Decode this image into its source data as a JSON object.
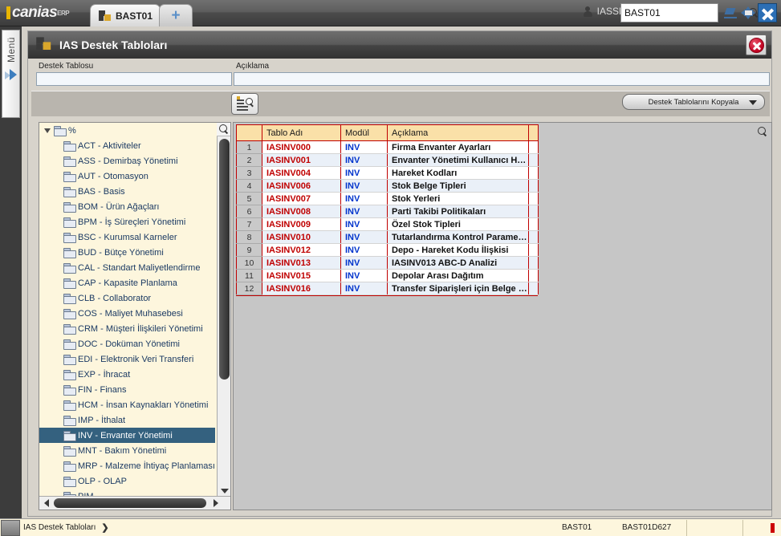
{
  "app": {
    "logo_text": "canias",
    "logo_sup": "ERP",
    "user": "IASSETUP",
    "command_value": "BAST01",
    "command_placeholder": ""
  },
  "tabs": [
    {
      "label": "BAST01",
      "icon": "puzzle-icon"
    },
    {
      "label": "+",
      "icon": "plus-icon"
    }
  ],
  "window_controls": {
    "minimize": "minimize-icon",
    "restore": "restore-icon",
    "close": "close-icon"
  },
  "rail": {
    "label": "Menü",
    "expand_icon": "expand-arrow-icon"
  },
  "dialog": {
    "title": "IAS Destek Tabloları",
    "close_label": "×"
  },
  "form": {
    "destek_tablosu": {
      "label": "Destek Tablosu",
      "value": "",
      "placeholder": ""
    },
    "aciklama": {
      "label": "Açıklama",
      "value": "",
      "placeholder": ""
    }
  },
  "toolbar": {
    "query_button": "query-icon",
    "copy_dropdown": "Destek Tablolarını Kopyala"
  },
  "tree": {
    "root": {
      "label": "%",
      "expanded": true
    },
    "items": [
      {
        "label": "ACT - Aktiviteler",
        "selected": false
      },
      {
        "label": "ASS - Demirbaş Yönetimi",
        "selected": false
      },
      {
        "label": "AUT - Otomasyon",
        "selected": false
      },
      {
        "label": "BAS - Basis",
        "selected": false
      },
      {
        "label": "BOM - Ürün Ağaçları",
        "selected": false
      },
      {
        "label": "BPM - İş Süreçleri Yönetimi",
        "selected": false
      },
      {
        "label": "BSC - Kurumsal Karneler",
        "selected": false
      },
      {
        "label": "BUD - Bütçe Yönetimi",
        "selected": false
      },
      {
        "label": "CAL - Standart Maliyetlendirme",
        "selected": false
      },
      {
        "label": "CAP - Kapasite Planlama",
        "selected": false
      },
      {
        "label": "CLB - Collaborator",
        "selected": false
      },
      {
        "label": "COS - Maliyet Muhasebesi",
        "selected": false
      },
      {
        "label": "CRM - Müşteri İlişkileri Yönetimi",
        "selected": false
      },
      {
        "label": "DOC - Doküman Yönetimi",
        "selected": false
      },
      {
        "label": "EDI - Elektronik Veri Transferi",
        "selected": false
      },
      {
        "label": "EXP - İhracat",
        "selected": false
      },
      {
        "label": "FIN - Finans",
        "selected": false
      },
      {
        "label": "HCM - İnsan Kaynakları Yönetimi",
        "selected": false
      },
      {
        "label": "IMP - İthalat",
        "selected": false
      },
      {
        "label": "INV - Envanter Yönetimi",
        "selected": true
      },
      {
        "label": "MNT - Bakım Yönetimi",
        "selected": false
      },
      {
        "label": "MRP - Malzeme İhtiyaç Planlaması",
        "selected": false
      },
      {
        "label": "OLP - OLAP",
        "selected": false
      },
      {
        "label": "PIM",
        "selected": false
      }
    ],
    "search_icon": "search-icon"
  },
  "grid": {
    "search_icon": "search-icon",
    "columns": [
      "",
      "Tablo Adı",
      "Modül",
      "Açıklama",
      ""
    ],
    "rows": [
      {
        "n": "1",
        "table": "IASINV000",
        "module": "INV",
        "desc": "Firma Envanter Ayarları"
      },
      {
        "n": "2",
        "table": "IASINV001",
        "module": "INV",
        "desc": "Envanter Yönetimi Kullanıcı Hakları"
      },
      {
        "n": "3",
        "table": "IASINV004",
        "module": "INV",
        "desc": "Hareket Kodları"
      },
      {
        "n": "4",
        "table": "IASINV006",
        "module": "INV",
        "desc": "Stok Belge Tipleri"
      },
      {
        "n": "5",
        "table": "IASINV007",
        "module": "INV",
        "desc": "Stok Yerleri"
      },
      {
        "n": "6",
        "table": "IASINV008",
        "module": "INV",
        "desc": "Parti Takibi Politikaları"
      },
      {
        "n": "7",
        "table": "IASINV009",
        "module": "INV",
        "desc": "Özel Stok Tipleri"
      },
      {
        "n": "8",
        "table": "IASINV010",
        "module": "INV",
        "desc": "Tutarlandırma Kontrol Parametrel..."
      },
      {
        "n": "9",
        "table": "IASINV012",
        "module": "INV",
        "desc": "Depo - Hareket Kodu İlişkisi"
      },
      {
        "n": "10",
        "table": "IASINV013",
        "module": "INV",
        "desc": "IASINV013 ABC-D Analizi"
      },
      {
        "n": "11",
        "table": "IASINV015",
        "module": "INV",
        "desc": "Depolar Arası Dağıtım"
      },
      {
        "n": "12",
        "table": "IASINV016",
        "module": "INV",
        "desc": "Transfer Siparişleri için Belge Tipi"
      }
    ]
  },
  "statusbar": {
    "context": "IAS Destek Tabloları",
    "arrow": "❯",
    "field1": "BAST01",
    "field2": "BAST01D627"
  },
  "colors": {
    "accent_gold": "#e8b500",
    "table_name": "#c00000",
    "module": "#0033cc",
    "selection": "#34617f",
    "tree_bg": "#fdf6dd",
    "header_bg": "#fae0a8"
  }
}
